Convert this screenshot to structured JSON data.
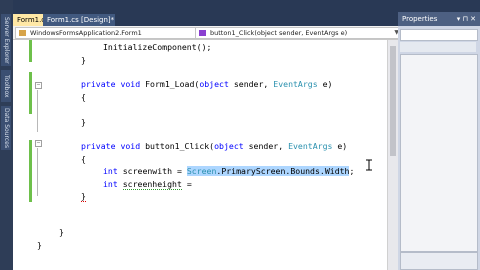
{
  "sidebar": {
    "tabs": [
      "Server Explorer",
      "Toolbox",
      "Data Sources"
    ]
  },
  "tabs": {
    "active": "Form1.cs*",
    "design": "Form1.cs [Design]*"
  },
  "navbar": {
    "class_combo": "WindowsFormsApplication2.Form1",
    "member_combo": "button1_Click(object sender, EventArgs e)"
  },
  "code": {
    "l1": "InitializeComponent();",
    "l2": "}",
    "l4_kw1": "private",
    "l4_kw2": "void",
    "l4_name": " Form1_Load(",
    "l4_kw3": "object",
    "l4_mid": " sender, ",
    "l4_ty": "EventArgs",
    "l4_end": " e)",
    "l5": "{",
    "l7": "}",
    "l9_name": " button1_Click(",
    "l10": "{",
    "l11_kw": "int",
    "l11_var": " screenwith = ",
    "l11_ty": "Screen",
    "l11_rest": ".PrimaryScreen.Bounds.Width",
    "l11_end": ";",
    "l12_kw": "int",
    "l12_var": "screenheight",
    "l12_eq": " =",
    "l13": "}",
    "l15": "}",
    "l16": "}"
  },
  "properties": {
    "title": "Properties",
    "pin": "▾ ⊓ ✕"
  },
  "colors": {
    "keyword": "#0000ff",
    "type": "#2b91af",
    "selection": "#add6ff",
    "chrome": "#293955",
    "changed_margin": "#6ec04b"
  }
}
